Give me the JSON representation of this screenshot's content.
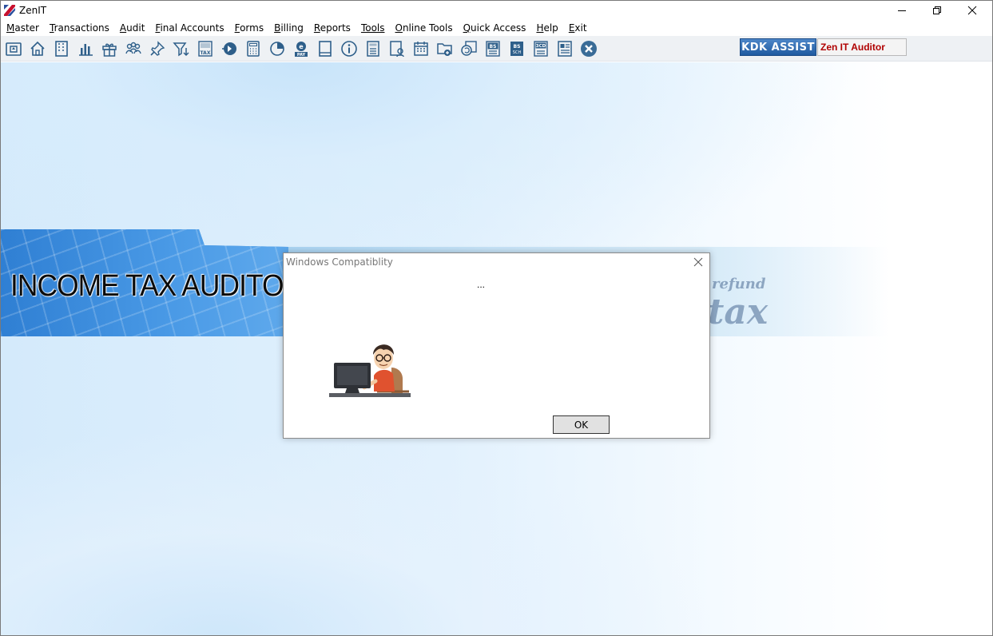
{
  "window": {
    "title": "ZenIT",
    "controls": {
      "minimize": "minimize-icon",
      "restore": "restore-icon",
      "close": "close-icon"
    }
  },
  "menu": [
    {
      "label": "Master",
      "accel": "M",
      "rest": "aster"
    },
    {
      "label": "Transactions",
      "accel": "T",
      "rest": "ransactions"
    },
    {
      "label": "Audit",
      "accel": "A",
      "rest": "udit"
    },
    {
      "label": "Final Accounts",
      "accel": "F",
      "rest": "inal Accounts"
    },
    {
      "label": "Forms",
      "accel": "F",
      "rest": "orms"
    },
    {
      "label": "Billing",
      "accel": "B",
      "rest": "illing"
    },
    {
      "label": "Reports",
      "accel": "R",
      "rest": "eports"
    },
    {
      "label": "Tools",
      "accel": "Tools",
      "rest": ""
    },
    {
      "label": "Online Tools",
      "accel": "O",
      "rest": "nline Tools"
    },
    {
      "label": "Quick Access",
      "accel": "Q",
      "rest": "uick Access"
    },
    {
      "label": "Help",
      "accel": "H",
      "rest": "elp"
    },
    {
      "label": "Exit",
      "accel": "E",
      "rest": "xit"
    }
  ],
  "toolbar": {
    "icons": [
      "assessment-icon",
      "home-icon",
      "building-icon",
      "bar-chart-icon",
      "gift-icon",
      "users-icon",
      "pin-icon",
      "filter-icon",
      "tax-icon",
      "forward-icon",
      "calculator-icon",
      "pie-chart-icon",
      "e-pay-icon",
      "book-icon",
      "info-icon",
      "report-icon",
      "user-card-icon",
      "calendar-icon",
      "add-folder-icon",
      "refresh-icon",
      "bs-icon",
      "bs-sch-icon",
      "3cd-icon",
      "form-icon",
      "close-circle-icon"
    ],
    "tax_label": "TAX",
    "pay_label": "PAY",
    "bs_label": "BS",
    "sch_label": "SCH",
    "cd_label": "3CD",
    "kdk_assist": "KDK ASSIST",
    "product_name": "Zen IT Auditor",
    "accent": "#1f5aa0",
    "product_color": "#b00000"
  },
  "banner": {
    "title": "INCOME TAX AUDITOR",
    "bg_words": [
      "refund",
      "tax"
    ]
  },
  "dialog": {
    "title": "Windows Compatiblity",
    "message": "...",
    "illustration": "person-at-computer-illustration",
    "ok_label": "OK"
  }
}
